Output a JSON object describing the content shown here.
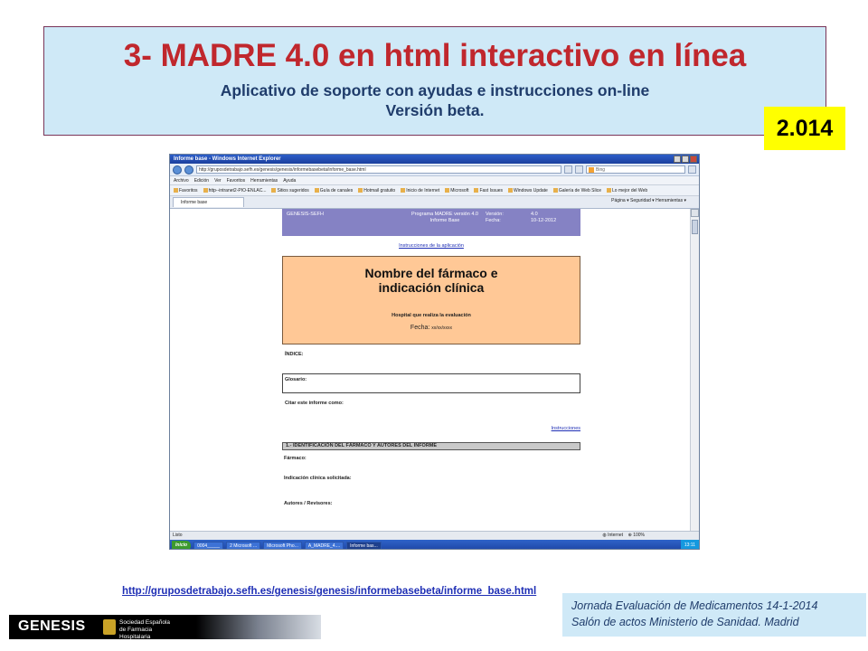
{
  "slide": {
    "title": "3- MADRE 4.0 en html interactivo en línea",
    "subtitle_line1": "Aplicativo de soporte con ayudas e instrucciones on-line",
    "subtitle_line2": "Versión beta.",
    "year_badge": "2.014",
    "url_link": "http://gruposdetrabajo.sefh.es/genesis/genesis/informebasebeta/informe_base.html",
    "event_line1": "Jornada Evaluación de Medicamentos 14-1-2014",
    "event_line2": "Salón de actos Ministerio de Sanidad. Madrid",
    "logo_text": "GENESIS",
    "logo_org": "Sociedad Española de Farmacia Hospitalaria"
  },
  "browser": {
    "window_title": "Informe base - Windows Internet Explorer",
    "address": "http://gruposdetrabajo.sefh.es/genesis/genesis/informebasebeta/informe_base.html",
    "search_placeholder": "Bing",
    "menu": [
      "Archivo",
      "Edición",
      "Ver",
      "Favoritos",
      "Herramientas",
      "Ayuda"
    ],
    "favorites": [
      "Favoritos",
      "http--intranet2-PIO-ENLAC...",
      "Sitios sugeridos",
      "Guía de canales",
      "Hotmail gratuito",
      "Inicio de Internet",
      "Microsoft",
      "Fast Issues",
      "Windows Update",
      "Galería de Web Slice",
      "Lo mejor del Web"
    ],
    "tab_label": "Informe base",
    "tab_tools": "Página ▾  Seguridad ▾  Herramientas ▾",
    "status_left": "Listo",
    "status_zone": "Internet",
    "status_zoom": "100%",
    "taskbar": {
      "start": "Inicio",
      "items": [
        "0004_____",
        "2 Microsoft ...",
        "Microsoft Pho...",
        "A_MADRE_4....",
        "Informe bas..."
      ],
      "clock": "13:11"
    }
  },
  "report": {
    "header_left": "GENESIS-SEFH",
    "header_center_1": "Programa MADRE versión 4.0",
    "header_center_2": "Informe Base",
    "version_label": "Versión:",
    "version_value": "4.0",
    "date_label": "Fecha:",
    "date_value": "10-12-2012",
    "instructions_link": "Instrucciones de la aplicación",
    "drug_title_1": "Nombre del fármaco e",
    "drug_title_2": "indicación clínica",
    "hospital_label": "Hospital que realiza la evaluación",
    "fecha_label": "Fecha:",
    "fecha_value": "xx/xx/xxxx",
    "indice_label": "ÍNDICE:",
    "glosario_label": "Glosario:",
    "citar_label": "Citar este informe como:",
    "instrucciones_right": "Instrucciones",
    "section1": "1.- IDENTIFICACIÓN DEL FÁRMACO Y AUTORES DEL INFORME",
    "farmaco_label": "Fármaco:",
    "indicacion_label": "Indicación clínica solicitada:",
    "autores_label": "Autores / Revisores:"
  }
}
